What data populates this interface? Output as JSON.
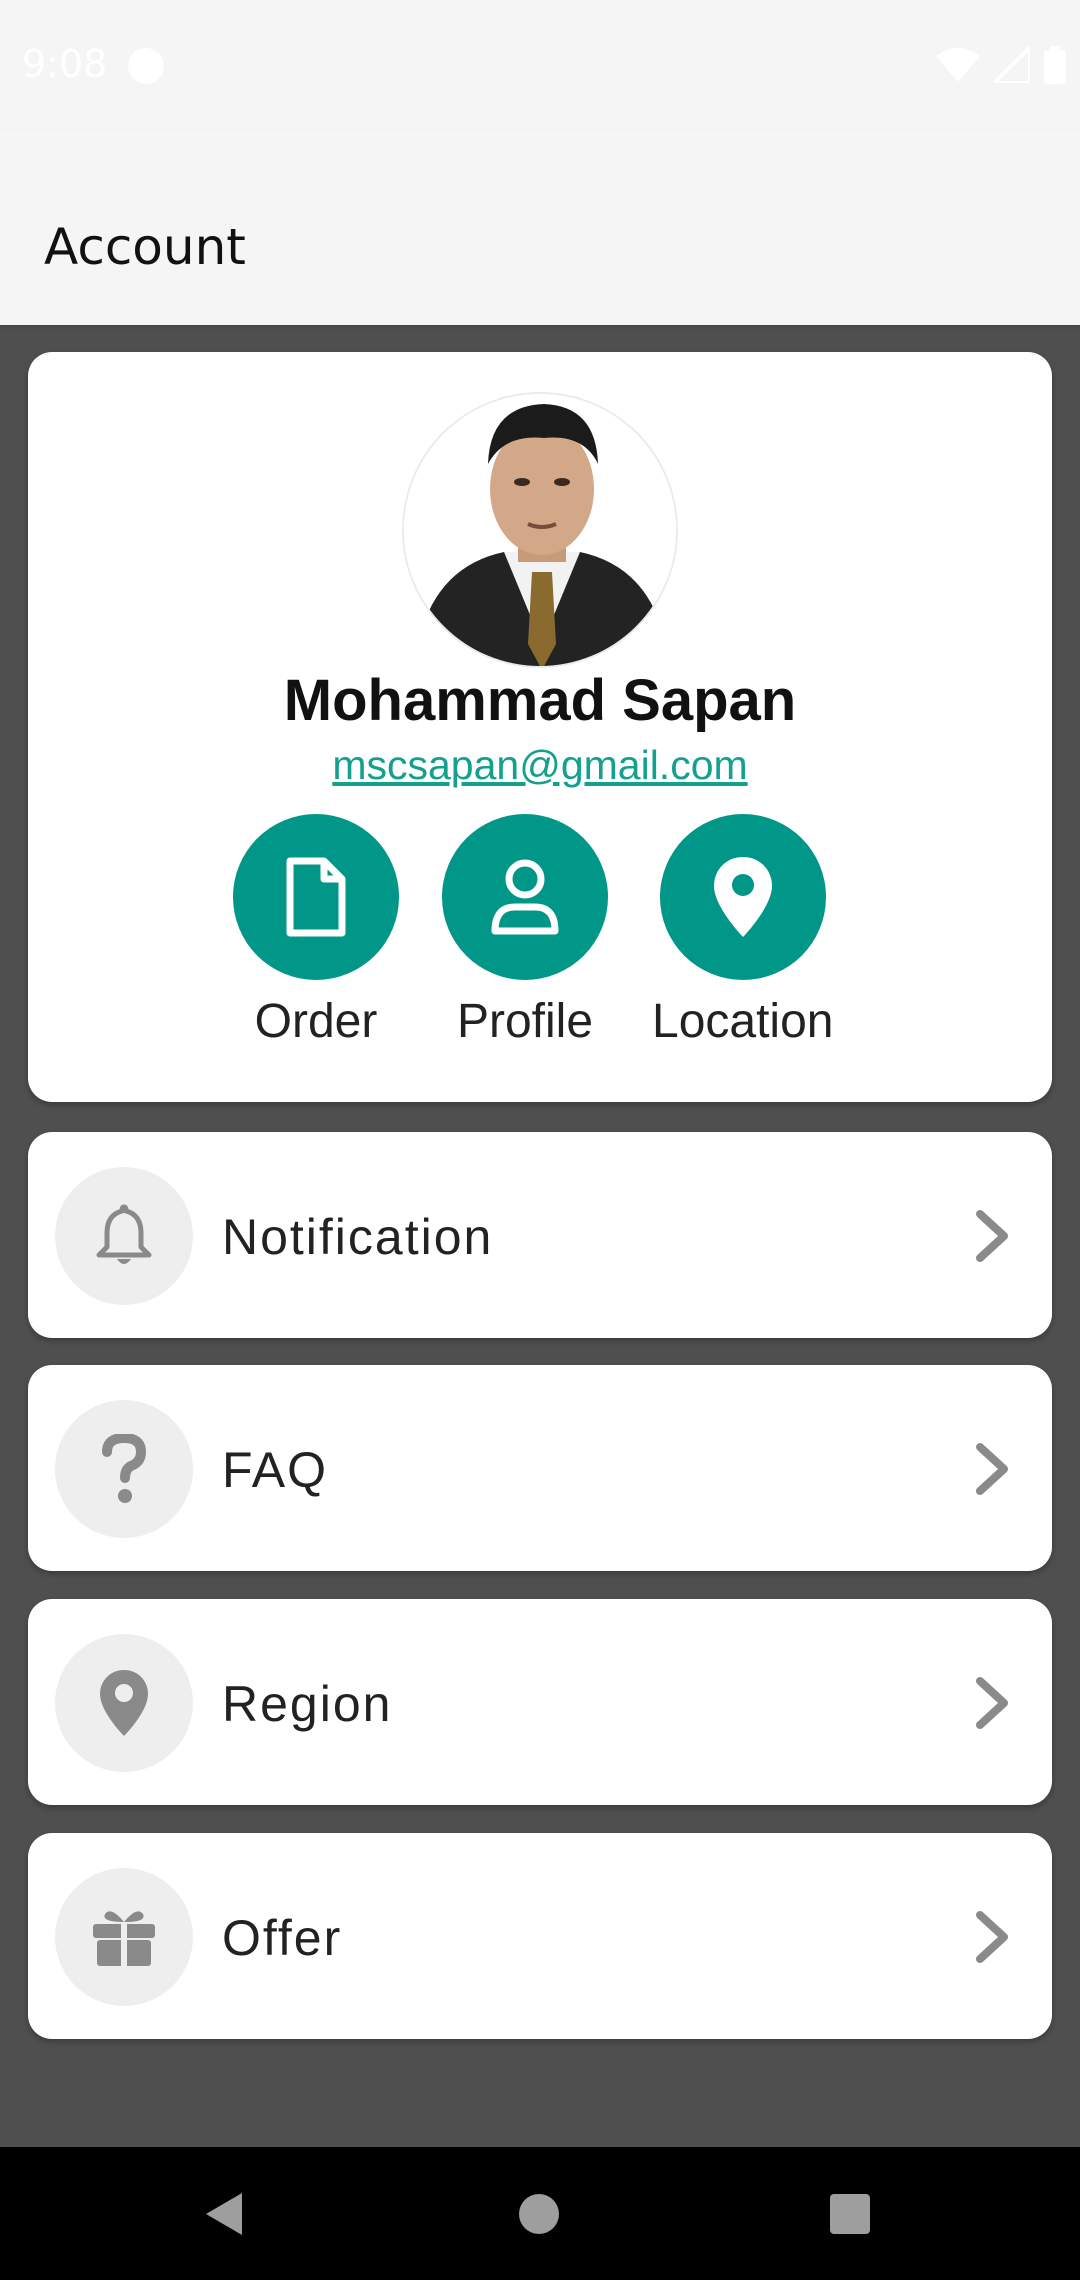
{
  "status_bar": {
    "time": "9:08"
  },
  "app_bar": {
    "title": "Account"
  },
  "profile": {
    "name": "Mohammad Sapan",
    "email": "mscsapan@gmail.com",
    "actions": [
      {
        "label": "Order",
        "icon": "file-icon"
      },
      {
        "label": "Profile",
        "icon": "person-icon"
      },
      {
        "label": "Location",
        "icon": "location-pin-icon"
      }
    ]
  },
  "menu": [
    {
      "label": "Notification",
      "icon": "bell-icon"
    },
    {
      "label": "FAQ",
      "icon": "question-icon"
    },
    {
      "label": "Region",
      "icon": "location-pin-icon"
    },
    {
      "label": "Offer",
      "icon": "gift-icon"
    }
  ],
  "colors": {
    "accent": "#009688",
    "link": "#14a08f",
    "background": "#4f4f4f",
    "icon_grey": "#8a8a8a"
  }
}
